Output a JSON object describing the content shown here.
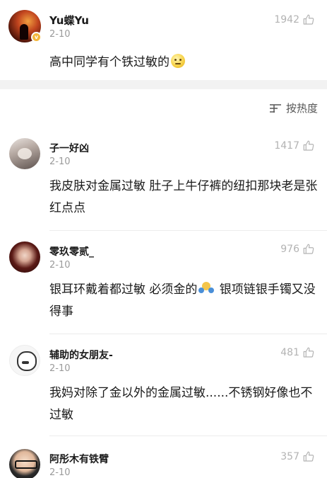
{
  "post": {
    "author": "Yu蝶Yu",
    "date": "2-10",
    "likes": "1942",
    "text": "高中同学有个铁过敏的",
    "emoji": "neutral-face-emoji"
  },
  "sort": {
    "label": "按热度",
    "icon": "sort-lines-icon"
  },
  "comments": [
    {
      "author": "子一好凶",
      "date": "2-10",
      "likes": "1417",
      "text": "我皮肤对金属过敏 肚子上牛仔裤的纽扣那块老是张红点点"
    },
    {
      "author": "零玖零贰_",
      "date": "2-10",
      "likes": "976",
      "text_before": "银耳环戴着都过敏  必须金的",
      "emoji": "hug-emoji",
      "text_after": "  银项链银手镯又没得事"
    },
    {
      "author": "辅助的女朋友-",
      "date": "2-10",
      "likes": "481",
      "text": "我妈对除了金以外的金属过敏......不锈钢好像也不过敏"
    },
    {
      "author": "阿彤木有铁臂",
      "date": "2-10",
      "likes": "357"
    }
  ],
  "colors": {
    "text": "#1a1a1a",
    "muted": "#9a9a9a",
    "likes": "#b3b3b3",
    "divider": "#f2f2f2",
    "badge": "#f4b73a"
  }
}
